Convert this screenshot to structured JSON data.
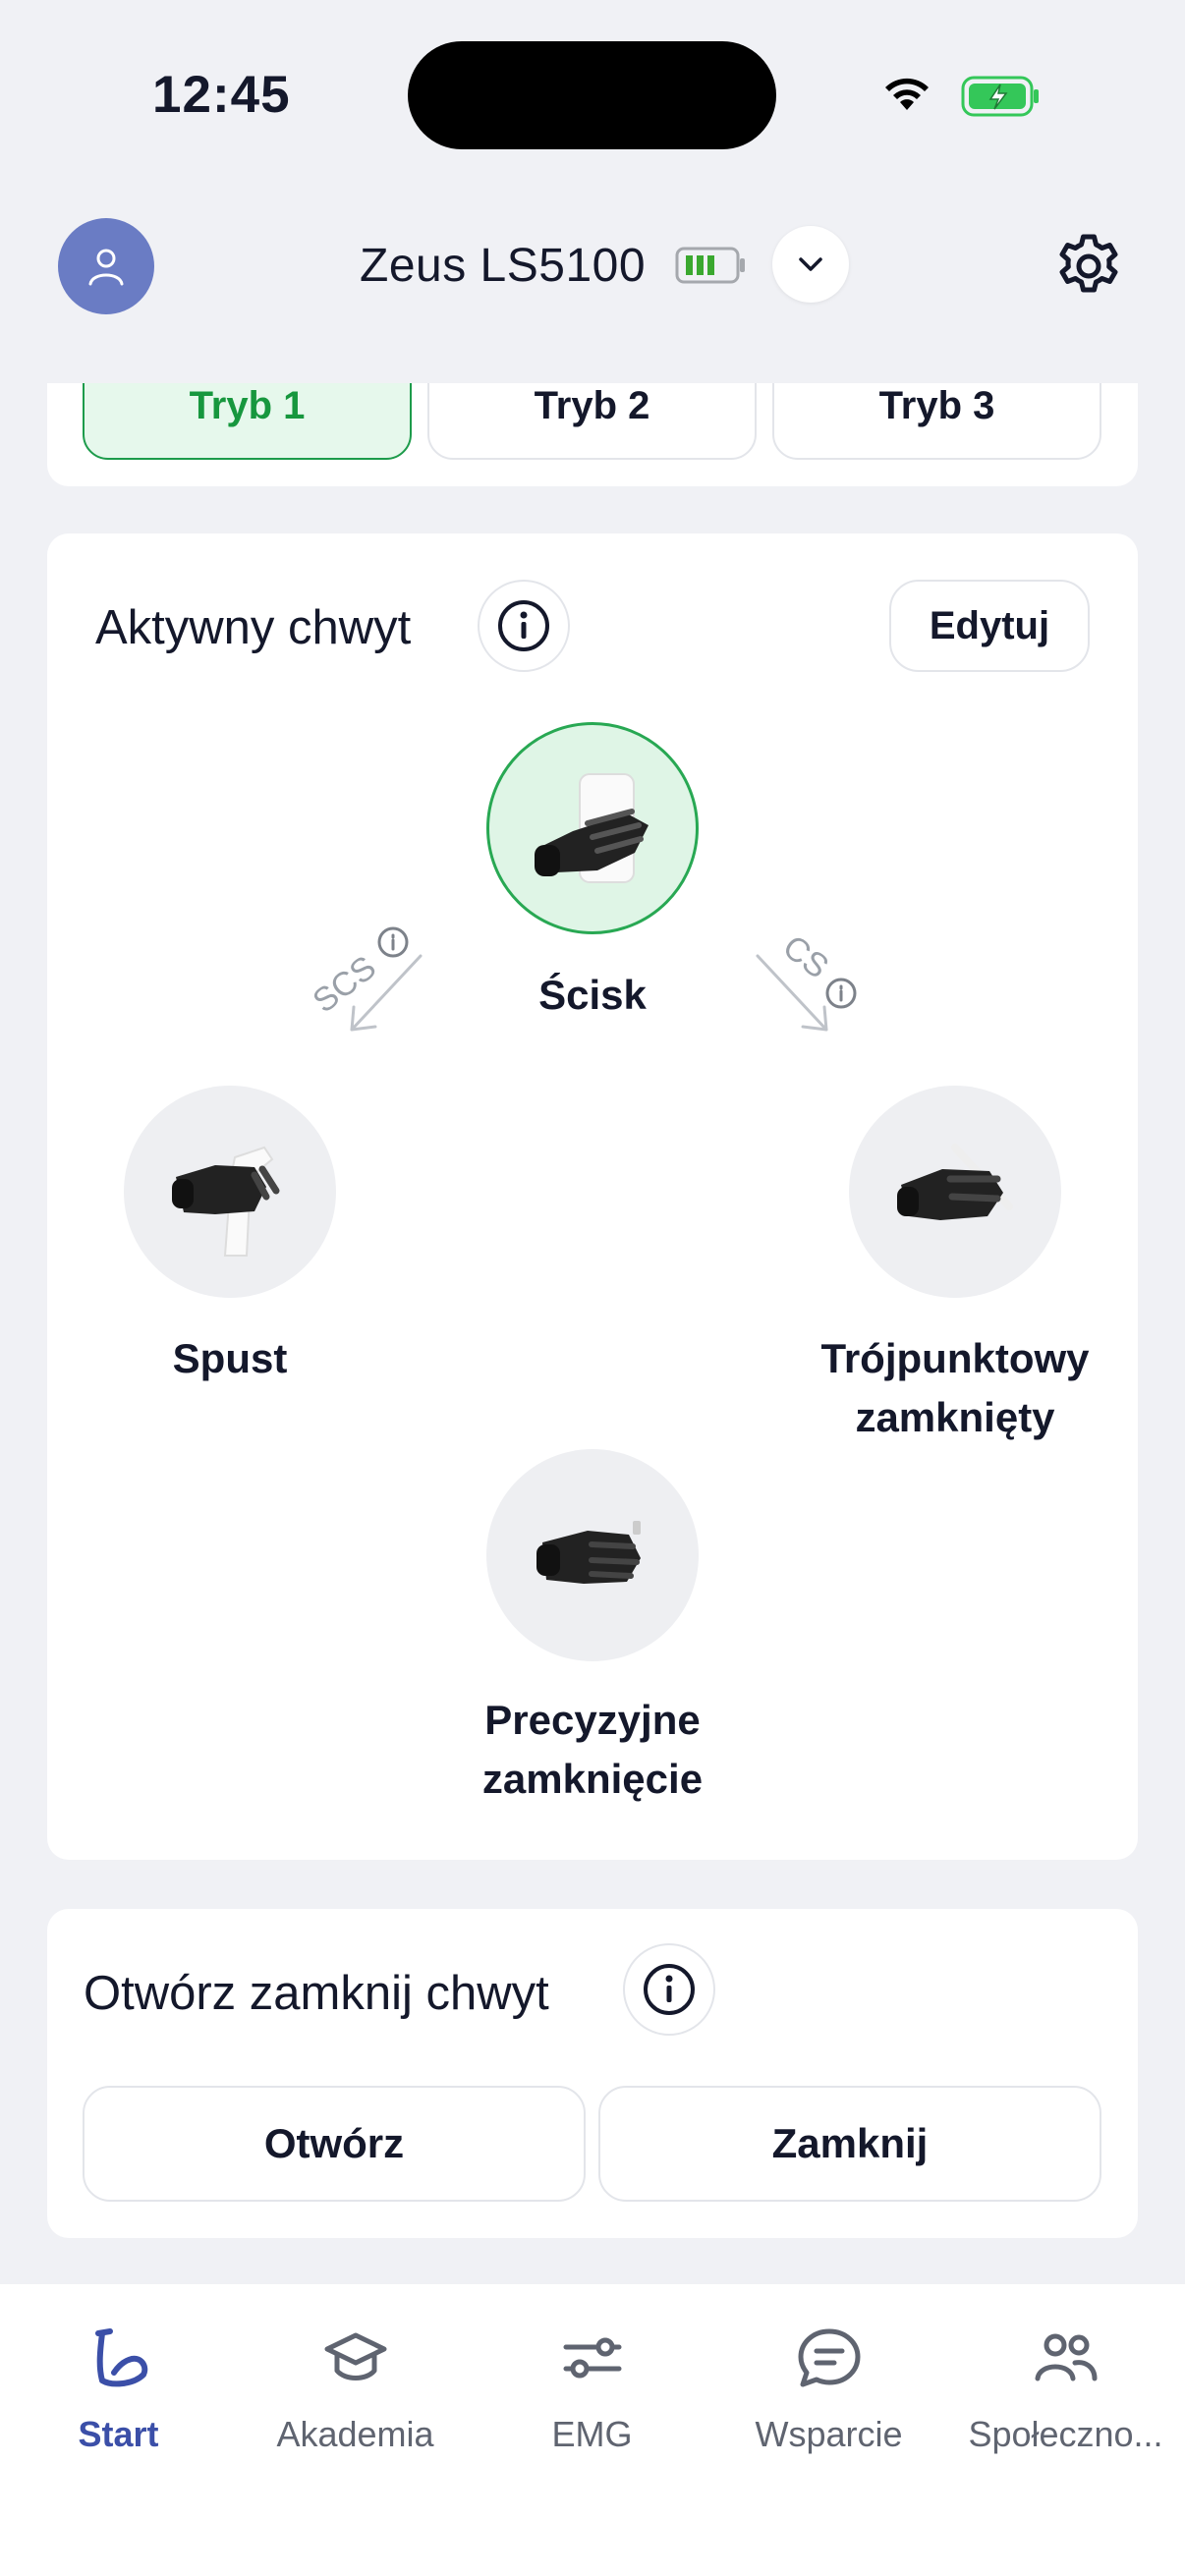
{
  "status_bar": {
    "time": "12:45"
  },
  "header": {
    "device_name": "Zeus LS5100",
    "device_battery_color": "#3aa82f"
  },
  "modes": [
    {
      "label": "Tryb 1",
      "active": true
    },
    {
      "label": "Tryb 2",
      "active": false
    },
    {
      "label": "Tryb 3",
      "active": false
    }
  ],
  "active_grip": {
    "title": "Aktywny chwyt",
    "edit_label": "Edytuj",
    "left_arrow_label": "SCS",
    "right_arrow_label": "CS",
    "grips": {
      "top": {
        "label": "Ścisk",
        "active": true
      },
      "left": {
        "label": "Spust"
      },
      "right": {
        "label": "Trójpunktowy zamknięty"
      },
      "bottom": {
        "label": "Precyzyjne zamknięcie"
      }
    }
  },
  "open_close": {
    "title": "Otwórz zamknij chwyt",
    "open_label": "Otwórz",
    "close_label": "Zamknij"
  },
  "bottom_nav": [
    {
      "label": "Start",
      "icon": "arm-icon",
      "active": true
    },
    {
      "label": "Akademia",
      "icon": "graduation-cap-icon"
    },
    {
      "label": "EMG",
      "icon": "sliders-icon"
    },
    {
      "label": "Wsparcie",
      "icon": "chat-bubble-icon"
    },
    {
      "label": "Społeczno...",
      "icon": "users-icon"
    }
  ],
  "colors": {
    "accent_green": "#1d9b4b",
    "nav_active": "#3b4fa8",
    "avatar_bg": "#6a7cc4"
  }
}
